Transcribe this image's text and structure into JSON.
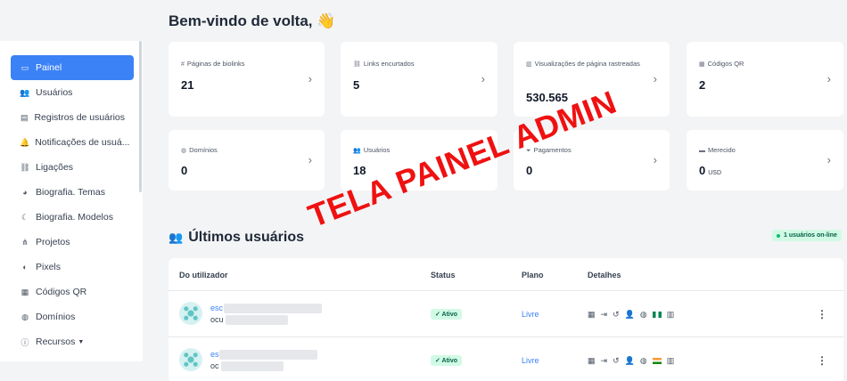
{
  "welcome": {
    "title": "Bem-vindo de volta,",
    "emoji": "👋"
  },
  "sidebar": {
    "items": [
      {
        "label": "Painel",
        "icon": "monitor-icon",
        "glyph": "▭",
        "active": true
      },
      {
        "label": "Usuários",
        "icon": "users-icon",
        "glyph": "👥",
        "active": false
      },
      {
        "label": "Registros de usuários",
        "icon": "log-icon",
        "glyph": "▤",
        "active": false
      },
      {
        "label": "Notificações de usuá...",
        "icon": "bell-icon",
        "glyph": "🔔",
        "active": false
      },
      {
        "label": "Ligações",
        "icon": "link-icon",
        "glyph": "⛓",
        "active": false
      },
      {
        "label": "Biografia. Temas",
        "icon": "palette-icon",
        "glyph": "◕",
        "active": false
      },
      {
        "label": "Biografia. Modelos",
        "icon": "moon-icon",
        "glyph": "☾",
        "active": false
      },
      {
        "label": "Projetos",
        "icon": "project-diagram-icon",
        "glyph": "⋔",
        "active": false
      },
      {
        "label": "Pixels",
        "icon": "adjust-icon",
        "glyph": "◐",
        "active": false
      },
      {
        "label": "Códigos QR",
        "icon": "qrcode-icon",
        "glyph": "▦",
        "active": false
      },
      {
        "label": "Domínios",
        "icon": "globe-icon",
        "glyph": "◍",
        "active": false
      },
      {
        "label": "Recursos",
        "icon": "info-circle-icon",
        "glyph": "ⓘ",
        "active": false,
        "caret": "▼"
      }
    ]
  },
  "stats": [
    {
      "label": "Páginas de biolinks",
      "value": "21",
      "icon": "hashtag-icon",
      "glyph": "#"
    },
    {
      "label": "Links encurtados",
      "value": "5",
      "icon": "link-icon",
      "glyph": "⛓"
    },
    {
      "label": "Visualizações de página rastreadas",
      "value": "530.565",
      "icon": "chart-icon",
      "glyph": "▥"
    },
    {
      "label": "Códigos QR",
      "value": "2",
      "icon": "qrcode-icon",
      "glyph": "▦"
    },
    {
      "label": "Domínios",
      "value": "0",
      "icon": "globe-icon",
      "glyph": "◍"
    },
    {
      "label": "Usuários",
      "value": "18",
      "icon": "users-icon",
      "glyph": "👥"
    },
    {
      "label": "Pagamentos",
      "value": "0",
      "icon": "funnel-icon",
      "glyph": "⏷"
    },
    {
      "label": "Merecido",
      "value": "0",
      "unit": "USD",
      "icon": "wallet-icon",
      "glyph": "▬"
    }
  ],
  "chevron": "›",
  "users_section": {
    "title": "Últimos usuários",
    "icon": "users-icon",
    "glyph": "👥",
    "online_badge": "1 usuários on-line",
    "headers": {
      "user": "Do utilizador",
      "status": "Status",
      "plan": "Plano",
      "details": "Detalhes"
    },
    "rows": [
      {
        "name_visible": "esc",
        "email_visible": "ocu",
        "status": "✓ Ativo",
        "plan": "Livre",
        "flag": "nigeria-flag-icon"
      },
      {
        "name_visible": "es",
        "email_visible": "oc",
        "status": "✓ Ativo",
        "plan": "Livre",
        "flag": "india-flag-icon"
      }
    ],
    "detail_icons": [
      "calendar-icon",
      "sign-in-icon",
      "history-icon",
      "user-cog-icon",
      "globe-icon"
    ],
    "detail_glyphs": [
      "▦",
      "⇥",
      "↺",
      "👤",
      "◍"
    ],
    "kebab": "⋮"
  },
  "watermark": "TELA PAINEL ADMIN",
  "colors": {
    "accent": "#3b82f6",
    "success_bg": "#d1fae5",
    "success_fg": "#065f46",
    "watermark": "#ef1111"
  }
}
